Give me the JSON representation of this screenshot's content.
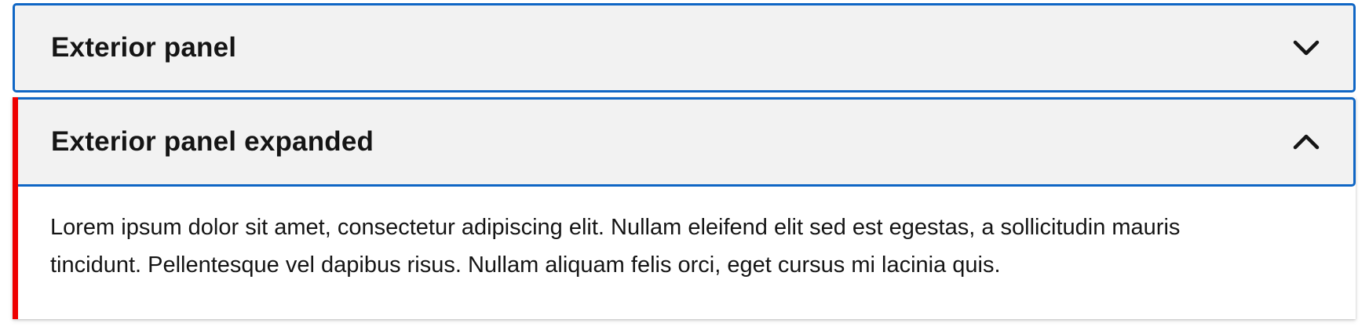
{
  "accordion": {
    "items": [
      {
        "title": "Exterior panel",
        "expanded": false,
        "chevron_icon": "chevron-down-icon"
      },
      {
        "title": "Exterior panel expanded",
        "expanded": true,
        "chevron_icon": "chevron-up-icon",
        "body_text": "Lorem ipsum dolor sit amet, consectetur adipiscing elit. Nullam eleifend elit sed est egestas, a sollicitudin mauris tincidunt. Pellentesque vel dapibus risus. Nullam aliquam felis orci, eget cursus mi lacinia quis."
      }
    ]
  },
  "colors": {
    "focus_border": "#0f66c5",
    "toggle_background": "#f2f2f2",
    "expanded_accent": "#ee0000",
    "text": "#151515"
  }
}
